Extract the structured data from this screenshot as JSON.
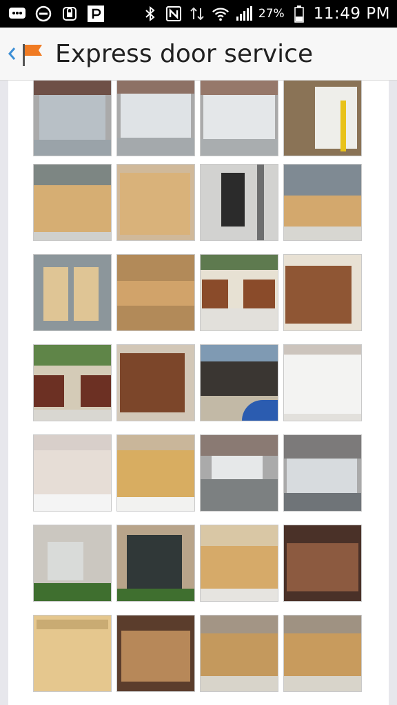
{
  "status_bar": {
    "battery_percent": "27%",
    "time": "11:49 PM",
    "icons": [
      "messages-icon",
      "do-not-disturb-icon",
      "lock-icon",
      "p-app-icon",
      "bluetooth-icon",
      "nfc-icon",
      "data-arrows-icon",
      "wifi-icon",
      "cell-signal-icon",
      "battery-icon"
    ]
  },
  "app_bar": {
    "title": "Express door service",
    "back_icon": "back-chevron-icon",
    "logo_icon": "flag-logo-icon",
    "accent_color": "#3d8fd6",
    "flag_color": "#f07b23"
  },
  "gallery": {
    "photos": [
      {
        "name": "gray-garage-door"
      },
      {
        "name": "white-carriage-door"
      },
      {
        "name": "white-carriage-door-2"
      },
      {
        "name": "garage-interior"
      },
      {
        "name": "cedar-door-house"
      },
      {
        "name": "cedar-door-closeup"
      },
      {
        "name": "jackshaft-opener"
      },
      {
        "name": "cedar-doors-house-2"
      },
      {
        "name": "cedar-panels-floor"
      },
      {
        "name": "cedar-panel-detail"
      },
      {
        "name": "stained-doors-house"
      },
      {
        "name": "stained-door-closeup"
      },
      {
        "name": "stained-doors-garage"
      },
      {
        "name": "stained-double-door"
      },
      {
        "name": "pool-cabana"
      },
      {
        "name": "white-door-windows"
      },
      {
        "name": "whitewash-door"
      },
      {
        "name": "cedar-door-windows"
      },
      {
        "name": "gray-door-stone-house"
      },
      {
        "name": "gray-door-driveway"
      },
      {
        "name": "window-arch"
      },
      {
        "name": "window-grid"
      },
      {
        "name": "cedar-door-windows-2"
      },
      {
        "name": "lit-garage-door"
      },
      {
        "name": "cedar-arch-door"
      },
      {
        "name": "dark-frame-door"
      },
      {
        "name": "cedar-door-row"
      },
      {
        "name": "cedar-door-row-2"
      }
    ]
  }
}
